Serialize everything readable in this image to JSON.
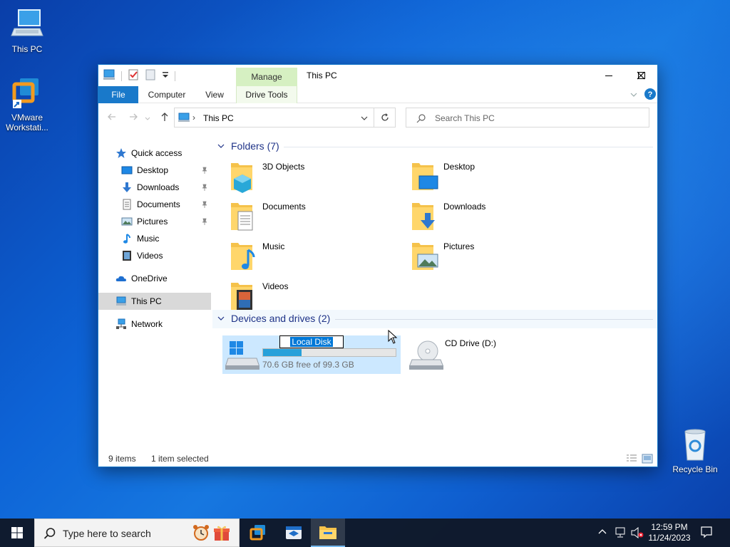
{
  "desktop": {
    "icons": [
      {
        "label": "This PC"
      },
      {
        "label_line1": "VMware",
        "label_line2": "Workstati..."
      },
      {
        "label": "Recycle Bin"
      }
    ]
  },
  "window": {
    "title": "This PC",
    "contextual_tab": "Manage",
    "ribbon_tabs": [
      "File",
      "Computer",
      "View",
      "Drive Tools"
    ],
    "address": "This PC",
    "search_placeholder": "Search This PC"
  },
  "nav": {
    "quick_access": "Quick access",
    "items": [
      "Desktop",
      "Downloads",
      "Documents",
      "Pictures",
      "Music",
      "Videos"
    ],
    "onedrive": "OneDrive",
    "this_pc": "This PC",
    "network": "Network"
  },
  "folders": {
    "header": "Folders (7)",
    "items": [
      "3D Objects",
      "Desktop",
      "Documents",
      "Downloads",
      "Music",
      "Pictures",
      "Videos"
    ]
  },
  "devices": {
    "header": "Devices and drives (2)",
    "local_disk": {
      "name": "Local Disk",
      "free_text": "70.6 GB free of 99.3 GB",
      "used_fraction": 0.289
    },
    "cd_drive": {
      "name": "CD Drive (D:)"
    }
  },
  "status": {
    "items": "9 items",
    "selected": "1 item selected"
  },
  "taskbar": {
    "search_placeholder": "Type here to search",
    "time": "12:59 PM",
    "date": "11/24/2023"
  },
  "colors": {
    "accent": "#1979ca",
    "selection": "#cce8ff",
    "usage_fill": "#26a0da",
    "manage_tab": "#d6f0c2"
  }
}
